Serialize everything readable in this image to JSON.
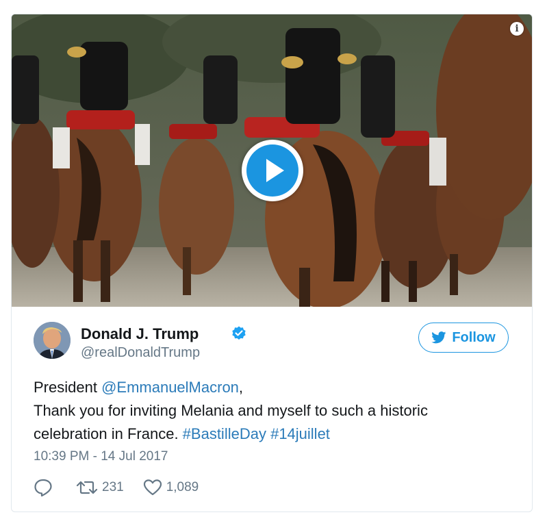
{
  "media": {
    "info_icon": "info-icon",
    "play_icon": "play-icon"
  },
  "user": {
    "name": "Donald J. Trump",
    "handle": "@realDonaldTrump",
    "verified_icon": "verified-badge-icon"
  },
  "follow": {
    "label": "Follow",
    "icon": "twitter-bird-icon"
  },
  "tweet": {
    "line1_prefix": "President ",
    "line1_mention": "@EmmanuelMacron",
    "line1_suffix": ",",
    "line2": "Thank you for inviting Melania and myself to such a historic",
    "line3_text": "celebration in France. ",
    "hashtag1": "#BastilleDay",
    "hashtag2": "#14juillet",
    "timestamp": "10:39 PM - 14 Jul 2017"
  },
  "actions": {
    "reply_icon": "reply-icon",
    "retweet_icon": "retweet-icon",
    "retweet_count": "231",
    "like_icon": "heart-icon",
    "like_count": "1,089"
  },
  "colors": {
    "link": "#2b7bb9",
    "accent": "#1b95e0",
    "muted": "#657786",
    "text": "#14171a",
    "border": "#e1e8ed"
  }
}
